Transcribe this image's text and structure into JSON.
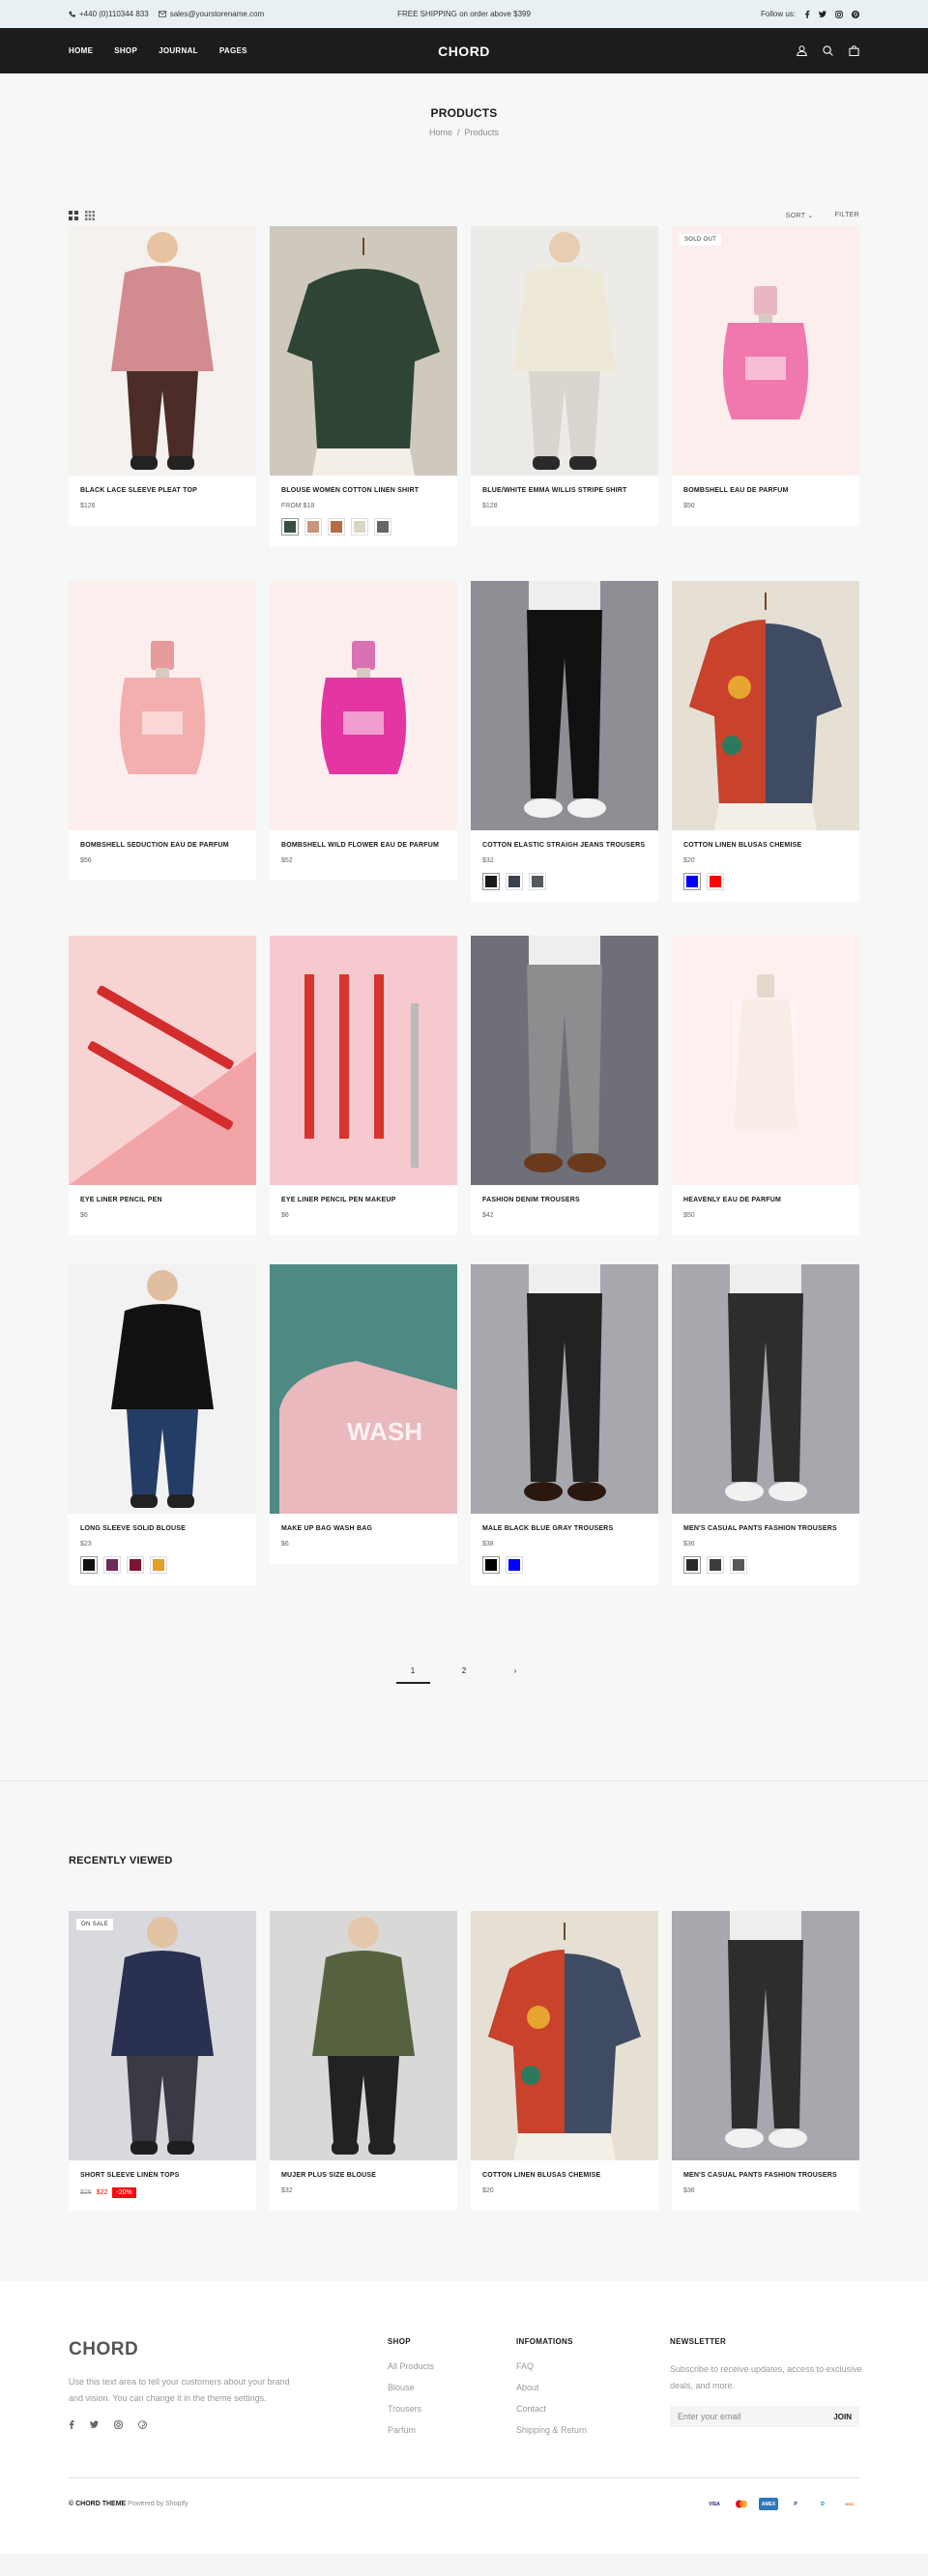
{
  "topbar": {
    "phone": "+440 (0)110344 833",
    "email": "sales@yourstorename.com",
    "promo": "FREE SHIPPING on order above $399",
    "follow": "Follow us:"
  },
  "header": {
    "nav": [
      "HOME",
      "SHOP",
      "JOURNAL",
      "PAGES"
    ],
    "logo": "CHORD"
  },
  "page": {
    "title": "PRODUCTS",
    "crumb_home": "Home",
    "crumb_sep": "/",
    "crumb_current": "Products"
  },
  "toolbar": {
    "sort": "SORT",
    "filter": "FILTER"
  },
  "products": [
    {
      "name": "BLACK LACE SLEEVE PLEAT TOP",
      "price": "$126",
      "badge": "",
      "swatches": [],
      "bg": "#f4f1ee"
    },
    {
      "name": "BLOUSE WOMEN COTTON LINEN SHIRT",
      "price": "FROM $18",
      "badge": "",
      "swatches": [
        "#36513f",
        "#c9957e",
        "#b46a43",
        "#dcd5c6",
        "#666666"
      ],
      "bg": "#cfc8bd"
    },
    {
      "name": "BLUE/WHITE EMMA WILLIS STRIPE SHIRT",
      "price": "$128",
      "badge": "",
      "swatches": [],
      "bg": "#ecebe8"
    },
    {
      "name": "BOMBSHELL EAU DE PARFUM",
      "price": "$50",
      "badge": "SOLD OUT",
      "swatches": [],
      "bg": "#fdeeee"
    },
    {
      "name": "BOMBSHELL SEDUCTION EAU DE PARFUM",
      "price": "$56",
      "badge": "",
      "swatches": [],
      "bg": "#fdeeee"
    },
    {
      "name": "BOMBSHELL WILD FLOWER EAU DE PARFUM",
      "price": "$52",
      "badge": "",
      "swatches": [],
      "bg": "#fdeeee"
    },
    {
      "name": "COTTON ELASTIC STRAIGH JEANS TROUSERS",
      "price": "$32",
      "badge": "",
      "swatches": [
        "#1a1a1a",
        "#3a4250",
        "#55595e"
      ],
      "bg": "#8d8f95"
    },
    {
      "name": "COTTON LINEN BLUSAS CHEMISE",
      "price": "$20",
      "badge": "",
      "swatches": [
        "#0000ff",
        "#ff0000"
      ],
      "bg": "#e5dfd4"
    },
    {
      "name": "EYE LINER PENCIL PEN",
      "price": "$6",
      "badge": "",
      "swatches": [],
      "bg": "#f3a4a7"
    },
    {
      "name": "EYE LINER PENCIL PEN MAKEUP",
      "price": "$6",
      "badge": "",
      "swatches": [],
      "bg": "#f5c9ce"
    },
    {
      "name": "FASHION DENIM TROUSERS",
      "price": "$42",
      "badge": "",
      "swatches": [],
      "bg": "#6e6f77"
    },
    {
      "name": "HEAVENLY EAU DE PARFUM",
      "price": "$50",
      "badge": "",
      "swatches": [],
      "bg": "#fdf0ee"
    },
    {
      "name": "LONG SLEEVE SOLID BLOUSE",
      "price": "$23",
      "badge": "",
      "swatches": [
        "#111111",
        "#6a2c58",
        "#7a1532",
        "#e0a02a"
      ],
      "bg": "#f2f2f2"
    },
    {
      "name": "MAKE UP BAG WASH BAG",
      "price": "$6",
      "badge": "",
      "swatches": [],
      "bg": "#4d8a83"
    },
    {
      "name": "MALE BLACK BLUE GRAY TROUSERS",
      "price": "$38",
      "badge": "",
      "swatches": [
        "#000000",
        "#0000ff"
      ],
      "bg": "#a7a8ad"
    },
    {
      "name": "MEN'S CASUAL PANTS FASHION TROUSERS",
      "price": "$36",
      "badge": "",
      "swatches": [
        "#2a2a2a",
        "#3c3c3c",
        "#595959"
      ],
      "bg": "#a7a8ad"
    }
  ],
  "pagination": {
    "pages": [
      "1",
      "2"
    ],
    "next": "›",
    "current": "1"
  },
  "recent": {
    "title": "RECENTLY VIEWED",
    "items": [
      {
        "name": "SHORT SLEEVE LINEN TOPS",
        "old_price": "$26",
        "price": "$22",
        "discount": "-20%",
        "badge": "ON SALE",
        "bg": "#d8d9dc"
      },
      {
        "name": "MUJER PLUS SIZE BLOUSE",
        "price": "$32",
        "badge": "",
        "bg": "#d8d8d6"
      },
      {
        "name": "COTTON LINEN BLUSAS CHEMISE",
        "price": "$20",
        "badge": "",
        "bg": "#e5dfd4"
      },
      {
        "name": "MEN'S CASUAL PANTS FASHION TROUSERS",
        "price": "$36",
        "badge": "",
        "bg": "#a7a8ad"
      }
    ]
  },
  "footer": {
    "logo": "CHORD",
    "description": "Use this text area to tell your customers about your brand and vision. You can change it in the theme settings.",
    "shop_title": "SHOP",
    "shop_links": [
      "All Products",
      "Blouse",
      "Trousers",
      "Parfum"
    ],
    "info_title": "INFOMATIONS",
    "info_links": [
      "FAQ",
      "About",
      "Contact",
      "Shipping & Return"
    ],
    "newsletter_title": "NEWSLETTER",
    "newsletter_text": "Subscribe to receive updates, access to exclusive deals, and more.",
    "email_placeholder": "Enter your email",
    "join": "JOIN",
    "copyright": "© CHORD THEME",
    "powered": "Powered by Shopify",
    "payments": [
      "VISA",
      "MC",
      "AMEX",
      "P",
      "D",
      "DISC"
    ]
  }
}
